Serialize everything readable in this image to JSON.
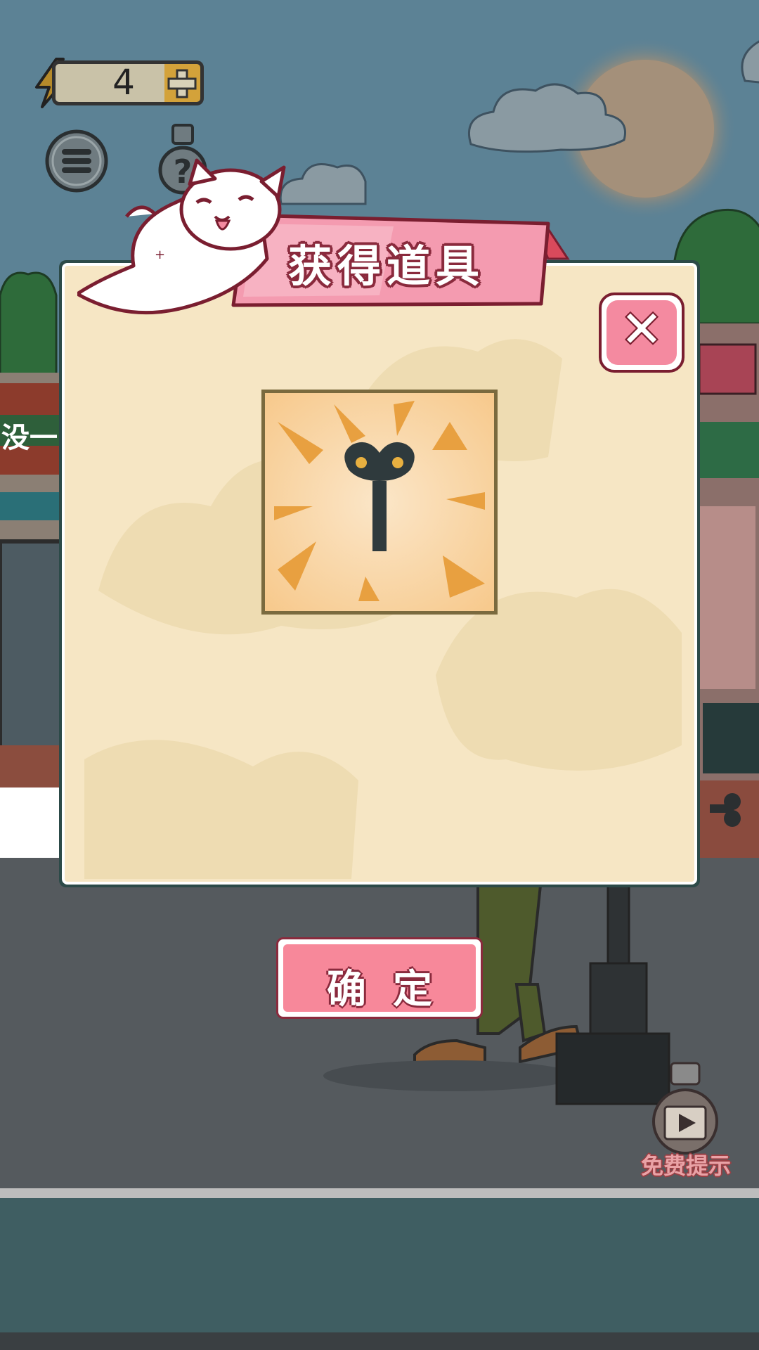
{
  "hud": {
    "energy_count": "4",
    "menu_icon": "menu-icon",
    "hint_icon": "lightbulb-question-icon"
  },
  "dialog": {
    "title": "获得道具",
    "item_icon": "wind-up-key-icon",
    "confirm_label": "确定",
    "close_icon": "close-icon",
    "mascot": "white-cat"
  },
  "scene": {
    "shop_sign": "没一",
    "free_hint_label": "免费提示",
    "free_hint_icon": "video-bulb-icon"
  },
  "colors": {
    "panel": "#f6e6c4",
    "banner_pink": "#f49bb0",
    "button_pink": "#f7889a",
    "sky": "#5c8295",
    "road": "#555a5e"
  }
}
